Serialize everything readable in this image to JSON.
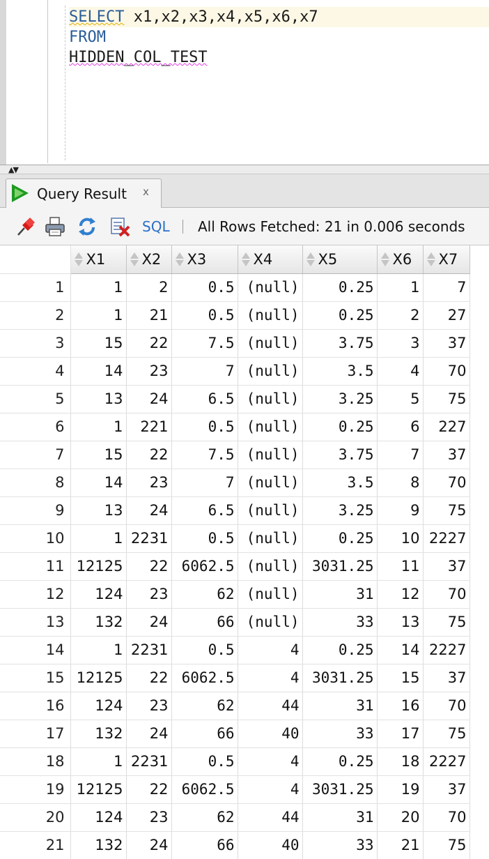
{
  "editor": {
    "lines": [
      {
        "keyword": "SELECT",
        "rest": " x1,x2,x3,x4,x5,x6,x7"
      },
      {
        "keyword": "FROM",
        "rest": ""
      },
      {
        "keyword": "",
        "rest": "HIDDEN_COL_TEST"
      }
    ]
  },
  "splitter": {
    "arrows": "▲▼"
  },
  "tab": {
    "label": "Query Result",
    "close": "x",
    "icon": "run-triangle-icon"
  },
  "toolbar": {
    "sql_label": "SQL",
    "separator": "|",
    "status": "All Rows Fetched: 21 in 0.006 seconds",
    "icons": [
      "pin-icon",
      "print-icon",
      "refresh-icon",
      "clear-icon"
    ]
  },
  "grid": {
    "columns": [
      "X1",
      "X2",
      "X3",
      "X4",
      "X5",
      "X6",
      "X7"
    ],
    "rows": [
      [
        "1",
        "1",
        "2",
        "0.5",
        "(null)",
        "0.25",
        "1",
        "7"
      ],
      [
        "2",
        "1",
        "21",
        "0.5",
        "(null)",
        "0.25",
        "2",
        "27"
      ],
      [
        "3",
        "15",
        "22",
        "7.5",
        "(null)",
        "3.75",
        "3",
        "37"
      ],
      [
        "4",
        "14",
        "23",
        "7",
        "(null)",
        "3.5",
        "4",
        "70"
      ],
      [
        "5",
        "13",
        "24",
        "6.5",
        "(null)",
        "3.25",
        "5",
        "75"
      ],
      [
        "6",
        "1",
        "221",
        "0.5",
        "(null)",
        "0.25",
        "6",
        "227"
      ],
      [
        "7",
        "15",
        "22",
        "7.5",
        "(null)",
        "3.75",
        "7",
        "37"
      ],
      [
        "8",
        "14",
        "23",
        "7",
        "(null)",
        "3.5",
        "8",
        "70"
      ],
      [
        "9",
        "13",
        "24",
        "6.5",
        "(null)",
        "3.25",
        "9",
        "75"
      ],
      [
        "10",
        "1",
        "2231",
        "0.5",
        "(null)",
        "0.25",
        "10",
        "2227"
      ],
      [
        "11",
        "12125",
        "22",
        "6062.5",
        "(null)",
        "3031.25",
        "11",
        "37"
      ],
      [
        "12",
        "124",
        "23",
        "62",
        "(null)",
        "31",
        "12",
        "70"
      ],
      [
        "13",
        "132",
        "24",
        "66",
        "(null)",
        "33",
        "13",
        "75"
      ],
      [
        "14",
        "1",
        "2231",
        "0.5",
        "4",
        "0.25",
        "14",
        "2227"
      ],
      [
        "15",
        "12125",
        "22",
        "6062.5",
        "4",
        "3031.25",
        "15",
        "37"
      ],
      [
        "16",
        "124",
        "23",
        "62",
        "44",
        "31",
        "16",
        "70"
      ],
      [
        "17",
        "132",
        "24",
        "66",
        "40",
        "33",
        "17",
        "75"
      ],
      [
        "18",
        "1",
        "2231",
        "0.5",
        "4",
        "0.25",
        "18",
        "2227"
      ],
      [
        "19",
        "12125",
        "22",
        "6062.5",
        "4",
        "3031.25",
        "19",
        "37"
      ],
      [
        "20",
        "124",
        "23",
        "62",
        "44",
        "31",
        "20",
        "70"
      ],
      [
        "21",
        "132",
        "24",
        "66",
        "40",
        "33",
        "21",
        "75"
      ]
    ]
  }
}
